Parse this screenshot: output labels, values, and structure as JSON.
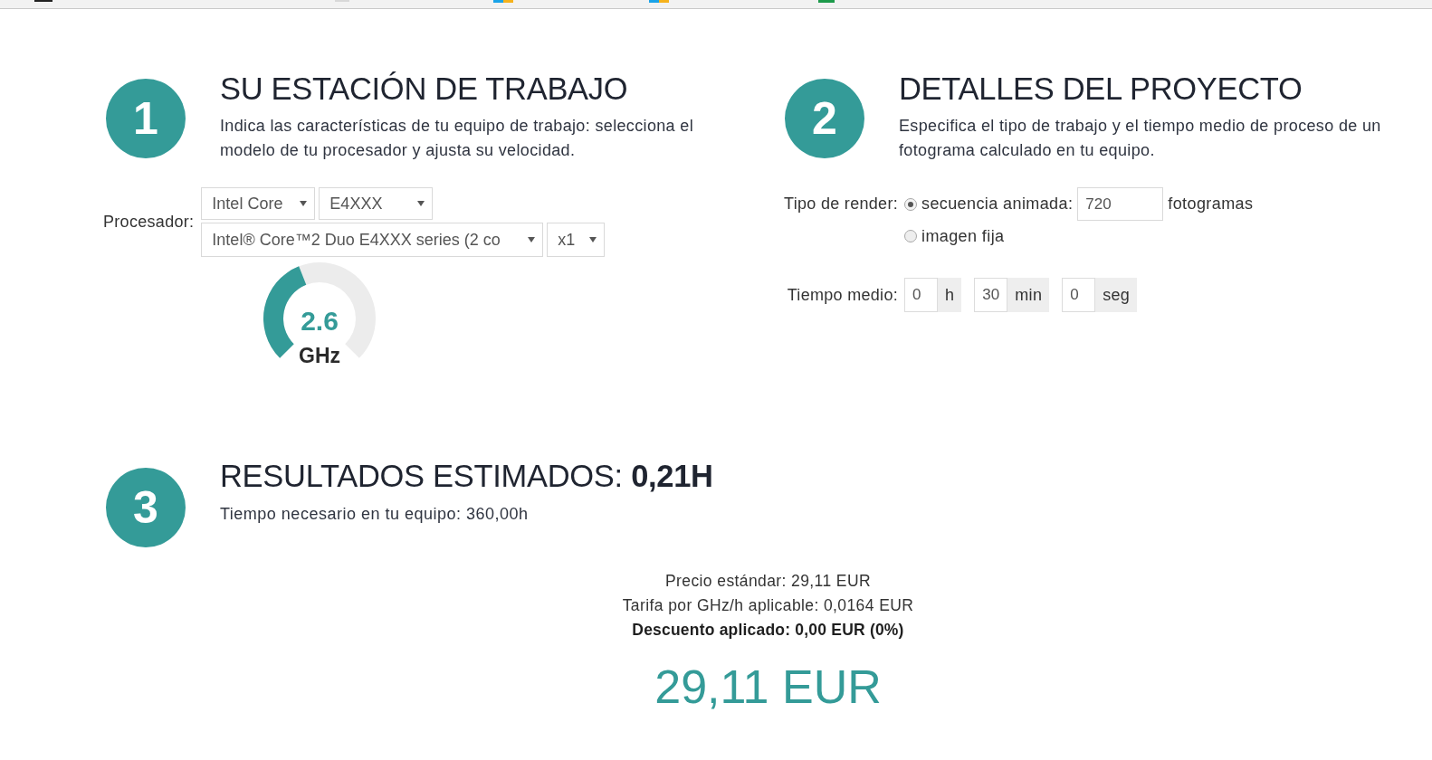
{
  "workstation": {
    "step": "1",
    "title": "SU ESTACIÓN DE TRABAJO",
    "description": "Indica las características de tu equipo de trabajo: selecciona el modelo de tu procesador y ajusta su velocidad.",
    "processor": {
      "label": "Procesador:",
      "select_rows": [
        [
          {
            "value": "Intel Core"
          },
          {
            "value": "E4XXX"
          }
        ],
        [
          {
            "value": "Intel® Core™2 Duo E4XXX series (2 co"
          },
          {
            "value": "x1"
          }
        ]
      ]
    },
    "speed_gauge": {
      "value": "2.6",
      "unit": "GHz",
      "level": 0.42
    }
  },
  "project": {
    "step": "2",
    "title": "DETALLES DEL PROYECTO",
    "description": "Especifica el tipo de trabajo y el tiempo medio de proceso de un fotograma calculado en tu equipo.",
    "render_type": {
      "label": "Tipo de render:",
      "options": [
        {
          "label": "secuencia animada:",
          "selected": true,
          "frames": {
            "value": "720",
            "unit": "fotogramas"
          }
        },
        {
          "label": "imagen fija",
          "selected": false
        }
      ]
    },
    "average_time": {
      "label": "Tiempo medio:",
      "fields": [
        {
          "value": "0",
          "unit": "h"
        },
        {
          "value": "30",
          "unit": "min"
        },
        {
          "value": "0",
          "unit": "seg"
        }
      ]
    }
  },
  "results": {
    "step": "3",
    "title": "RESULTADOS ESTIMADOS: **0,21H**",
    "subtitle": "Tiempo necesario en tu equipo: 360,00h",
    "summary_lines": [
      {
        "text": "Precio estándar: 29,11 EUR",
        "bold": false
      },
      {
        "text": "Tarifa por GHz/h aplicable: 0,0164 EUR",
        "bold": false
      },
      {
        "text": "Descuento aplicado: 0,00 EUR (0%)",
        "bold": true
      }
    ],
    "total": "29,11 EUR"
  }
}
